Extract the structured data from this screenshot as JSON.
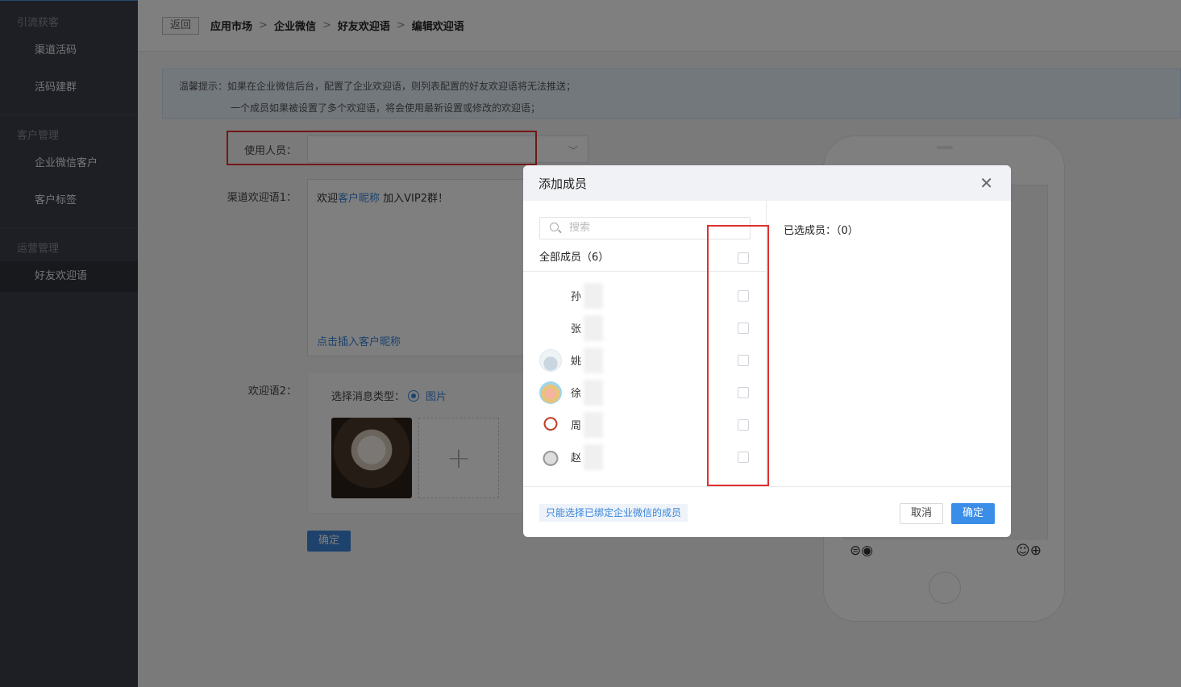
{
  "sidebar": {
    "groups": [
      {
        "title": "引流获客",
        "items": [
          "渠道活码",
          "活码建群"
        ]
      },
      {
        "title": "客户管理",
        "items": [
          "企业微信客户",
          "客户标签"
        ]
      },
      {
        "title": "运营管理",
        "items": [
          "好友欢迎语"
        ]
      }
    ]
  },
  "topbar": {
    "back_label": "返回",
    "breadcrumb": [
      "应用市场",
      "企业微信",
      "好友欢迎语",
      "编辑欢迎语"
    ]
  },
  "tip": {
    "line1": "温馨提示：如果在企业微信后台，配置了企业欢迎语，则列表配置的好友欢迎语将无法推送；",
    "line2": "一个成员如果被设置了多个欢迎语，将会使用最新设置或修改的欢迎语；"
  },
  "form": {
    "user_label": "使用人员：",
    "welcome1_label": "渠道欢迎语1：",
    "welcome1_prefix": "欢迎",
    "welcome1_nickname": "客户昵称",
    "welcome1_suffix": " 加入VIP2群！",
    "insert_nickname_link": "点击插入客户昵称",
    "welcome2_label": "欢迎语2：",
    "msg_type_label": "选择消息类型：",
    "msg_type_value": "图片",
    "add_symbol": "+",
    "confirm_label": "确定"
  },
  "modal": {
    "title": "添加成员",
    "close_symbol": "✕",
    "search_placeholder": "搜索",
    "all_members_label": "全部成员（6）",
    "members": [
      {
        "name": "孙"
      },
      {
        "name": "张"
      },
      {
        "name": "姚"
      },
      {
        "name": "徐"
      },
      {
        "name": "周"
      },
      {
        "name": "赵"
      }
    ],
    "selected_label": "已选成员：（0）",
    "hint": "只能选择已绑定企业微信的成员",
    "cancel_label": "取消",
    "ok_label": "确定"
  }
}
